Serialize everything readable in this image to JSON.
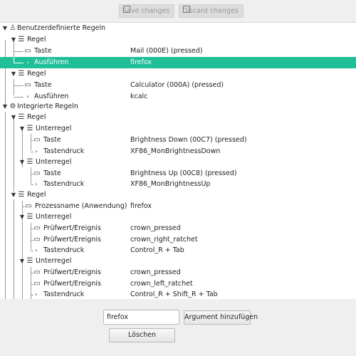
{
  "toolbar": {
    "save_label": "Save changes",
    "discard_label": "Discard changes"
  },
  "tree": {
    "rows": [
      {
        "label": "Benutzerdefinierte Regeln",
        "value": ""
      },
      {
        "label": "Regel",
        "value": ""
      },
      {
        "label": "Taste",
        "value": "Mail (000E) (pressed)"
      },
      {
        "label": "Ausführen",
        "value": "firefox"
      },
      {
        "label": "Regel",
        "value": ""
      },
      {
        "label": "Taste",
        "value": "Calculator (000A) (pressed)"
      },
      {
        "label": "Ausführen",
        "value": "kcalc"
      },
      {
        "label": "Integrierte Regeln",
        "value": ""
      },
      {
        "label": "Regel",
        "value": ""
      },
      {
        "label": "Unterregel",
        "value": ""
      },
      {
        "label": "Taste",
        "value": "Brightness Down (00C7) (pressed)"
      },
      {
        "label": "Tastendruck",
        "value": "XF86_MonBrightnessDown"
      },
      {
        "label": "Unterregel",
        "value": ""
      },
      {
        "label": "Taste",
        "value": "Brightness Up (00C8) (pressed)"
      },
      {
        "label": "Tastendruck",
        "value": "XF86_MonBrightnessUp"
      },
      {
        "label": "Regel",
        "value": ""
      },
      {
        "label": "Prozessname (Anwendung)",
        "value": "firefox"
      },
      {
        "label": "Unterregel",
        "value": ""
      },
      {
        "label": "Prüfwert/Ereignis",
        "value": "crown_pressed"
      },
      {
        "label": "Prüfwert/Ereignis",
        "value": "crown_right_ratchet"
      },
      {
        "label": "Tastendruck",
        "value": "Control_R + Tab"
      },
      {
        "label": "Unterregel",
        "value": ""
      },
      {
        "label": "Prüfwert/Ereignis",
        "value": "crown_pressed"
      },
      {
        "label": "Prüfwert/Ereignis",
        "value": "crown_left_ratchet"
      },
      {
        "label": "Tastendruck",
        "value": "Control_R + Shift_R + Tab"
      }
    ]
  },
  "editor": {
    "argument_value": "firefox",
    "add_argument_label": "Argument hinzufügen",
    "delete_label": "Löschen"
  }
}
